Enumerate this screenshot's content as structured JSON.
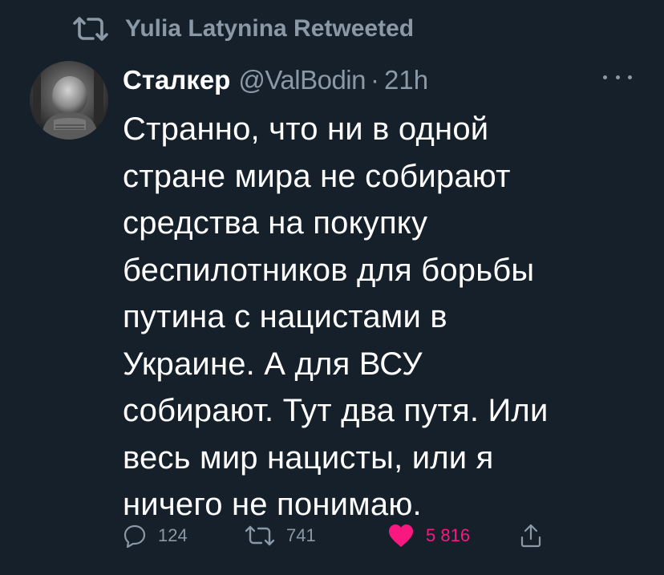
{
  "retweet": {
    "icon": "retweet-icon",
    "text": "Yulia Latynina Retweeted"
  },
  "author": {
    "name": "Сталкер",
    "handle": "@ValBodin",
    "separator": "·",
    "time": "21h",
    "avatar_icon": "avatar-photo"
  },
  "more_icon": "more-options-icon",
  "tweet": {
    "lines": [
      "Странно, что ни в одной",
      "стране мира не собирают",
      "средства на покупку",
      "беспилотников для борьбы",
      "путина с нацистами в",
      "Украине. А для ВСУ",
      "собирают. Тут два путя. Или",
      "весь мир нацисты, или я",
      "ничего не понимаю."
    ]
  },
  "actions": {
    "reply": {
      "icon": "reply-icon",
      "count": "124"
    },
    "retweet": {
      "icon": "retweet-icon",
      "count": "741"
    },
    "like": {
      "icon": "heart-icon",
      "count": "5 816",
      "liked": true
    },
    "share": {
      "icon": "share-icon"
    }
  },
  "colors": {
    "background": "#15202b",
    "text": "#ffffff",
    "secondary": "#8b98a5",
    "like": "#f91880"
  }
}
